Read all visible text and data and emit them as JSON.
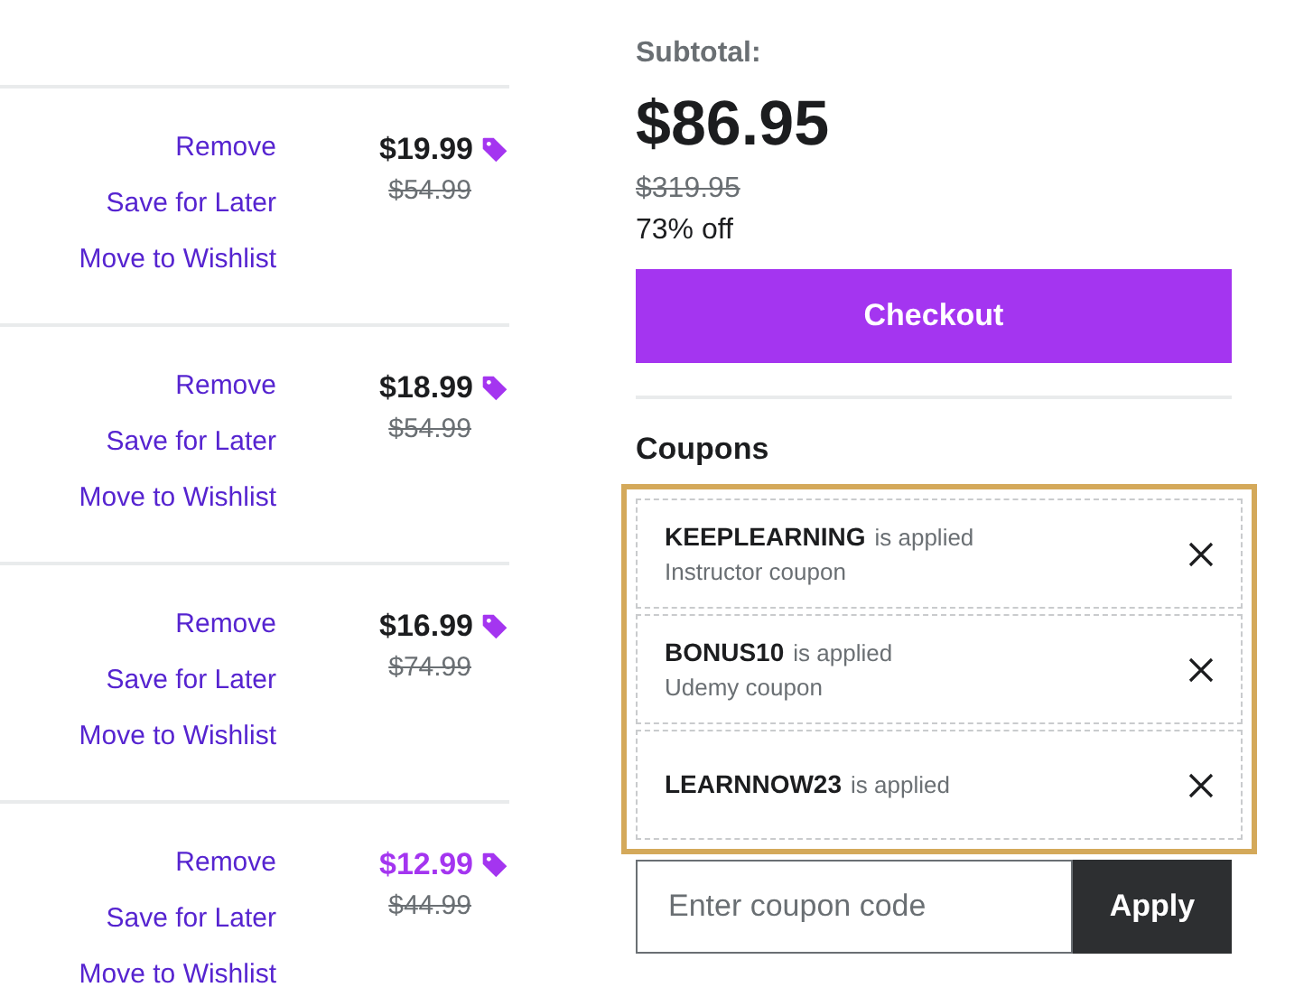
{
  "cart_items": [
    {
      "links": [
        "Remove",
        "Save for Later",
        "Move to Wishlist"
      ],
      "price": "$19.99",
      "original_price": "$54.99",
      "highlighted": false
    },
    {
      "links": [
        "Remove",
        "Save for Later",
        "Move to Wishlist"
      ],
      "price": "$18.99",
      "original_price": "$54.99",
      "highlighted": false
    },
    {
      "links": [
        "Remove",
        "Save for Later",
        "Move to Wishlist"
      ],
      "price": "$16.99",
      "original_price": "$74.99",
      "highlighted": false
    },
    {
      "links": [
        "Remove",
        "Save for Later",
        "Move to Wishlist"
      ],
      "price": "$12.99",
      "original_price": "$44.99",
      "highlighted": true
    }
  ],
  "summary": {
    "label": "Subtotal:",
    "total": "$86.95",
    "original_total": "$319.95",
    "discount": "73% off",
    "checkout_button": "Checkout"
  },
  "coupons": {
    "title": "Coupons",
    "items": [
      {
        "code": "KEEPLEARNING",
        "status": "is applied",
        "type": "Instructor coupon"
      },
      {
        "code": "BONUS10",
        "status": "is applied",
        "type": "Udemy coupon"
      },
      {
        "code": "LEARNNOW23",
        "status": "is applied"
      }
    ],
    "input": {
      "placeholder": "Enter coupon code"
    },
    "apply_button": "Apply"
  }
}
